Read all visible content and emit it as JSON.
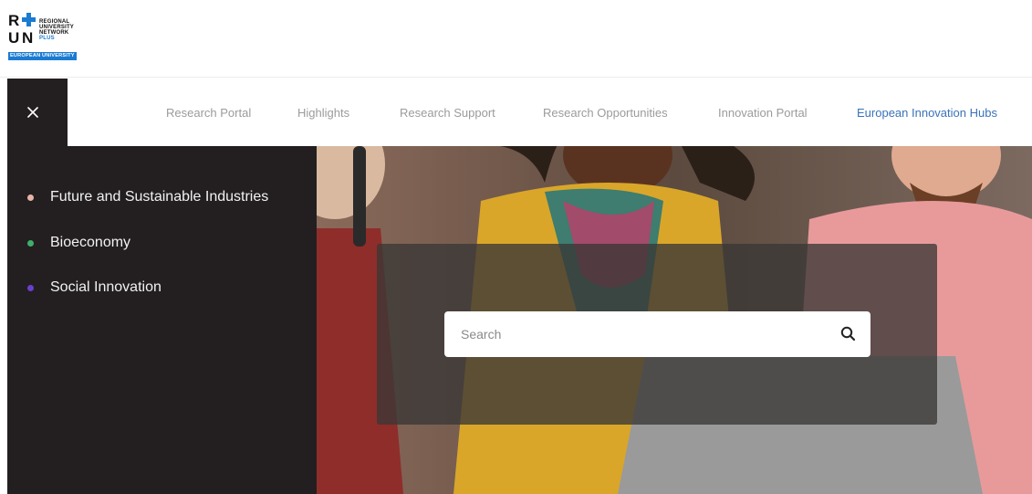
{
  "logo": {
    "letters": [
      "R",
      "U",
      "N"
    ],
    "lines": [
      "REGIONAL",
      "UNIVERSITY",
      "NETWORK",
      "PLUS"
    ],
    "badge": "EUROPEAN UNIVERSITY"
  },
  "nav": {
    "close_icon": "close-icon",
    "links": [
      {
        "label": "Research Portal",
        "active": false
      },
      {
        "label": "Highlights",
        "active": false
      },
      {
        "label": "Research Support",
        "active": false
      },
      {
        "label": "Research Opportunities",
        "active": false
      },
      {
        "label": "Innovation Portal",
        "active": false
      },
      {
        "label": "European Innovation Hubs",
        "active": true
      }
    ]
  },
  "sidebar": {
    "items": [
      {
        "label": "Future and Sustainable Industries",
        "dot_color": "#e8b4a8"
      },
      {
        "label": "Bioeconomy",
        "dot_color": "#3fae6a"
      },
      {
        "label": "Social Innovation",
        "dot_color": "#6a3fd0"
      }
    ]
  },
  "search": {
    "placeholder": "Search",
    "icon": "search-icon"
  },
  "colors": {
    "accent": "#1b7bd1",
    "dark_panel": "#231f20",
    "active_nav": "#3a72b8",
    "nav_text": "#9b9b9b"
  }
}
